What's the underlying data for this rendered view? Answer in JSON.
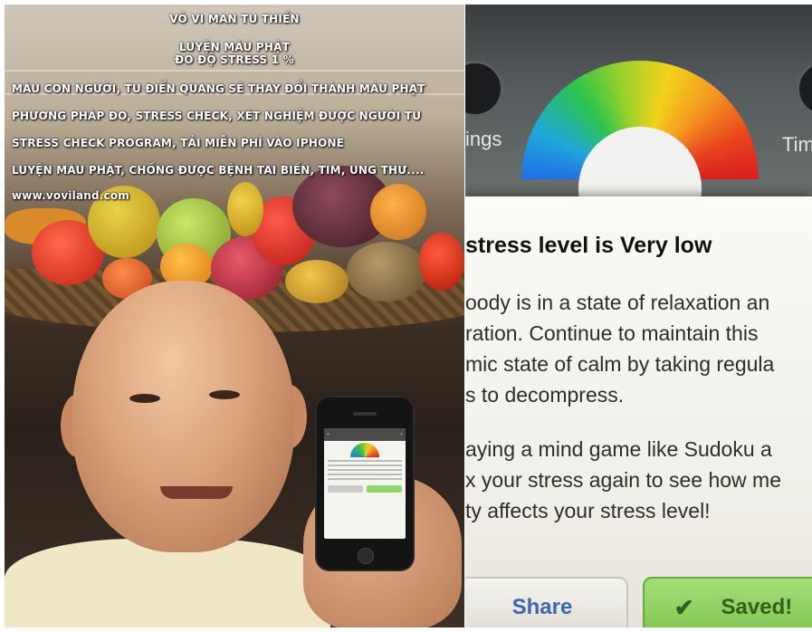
{
  "left_photo": {
    "overlay": {
      "line1": "VÔ VI MAN TU THIỀN",
      "line2": "LUYỆN MÁU PHẬT",
      "line3": "ĐO ĐỘ STRESS 1 %",
      "line4": "MÁU CON NGƯỜI, TU ĐIỂN QUANG SẼ THAY ĐỔI THÀNH MÁU PHẬT",
      "line5": "PHƯƠNG PHÁP ĐO, STRESS CHECK, XÉT NGHIỆM ĐƯỢC NGƯỜI TU",
      "line6": "STRESS CHECK PROGRAM, TẢI MIỄN PHÍ VÀO IPHONE",
      "line7": "LUYỆN MÁU PHẬT, CHỐNG ĐƯỢC BỆNH TAI BIẾN, TIM, UNG THƯ....",
      "website": "www.voviland.com"
    }
  },
  "right_photo": {
    "header": {
      "left_label": "ings",
      "right_label": "Tim"
    },
    "gauge": {
      "value": "1%",
      "level_fraction": 0.01,
      "colors": [
        "#1f6fe6",
        "#2cc44a",
        "#f2d21c",
        "#f49a1e",
        "#d81e1e"
      ]
    },
    "card": {
      "title": "stress level is Very low",
      "para1": [
        "oody is in a state of relaxation an",
        "ration. Continue to maintain this",
        "mic state of calm by taking regula",
        "s to decompress."
      ],
      "para2": [
        "aying a mind game like Sudoku a",
        "x your stress again to see how me",
        "ty affects your stress level!"
      ]
    },
    "buttons": {
      "share": "Share",
      "saved": "Saved!",
      "saved_icon": "check-icon",
      "saved_color": "#8fd162"
    }
  }
}
